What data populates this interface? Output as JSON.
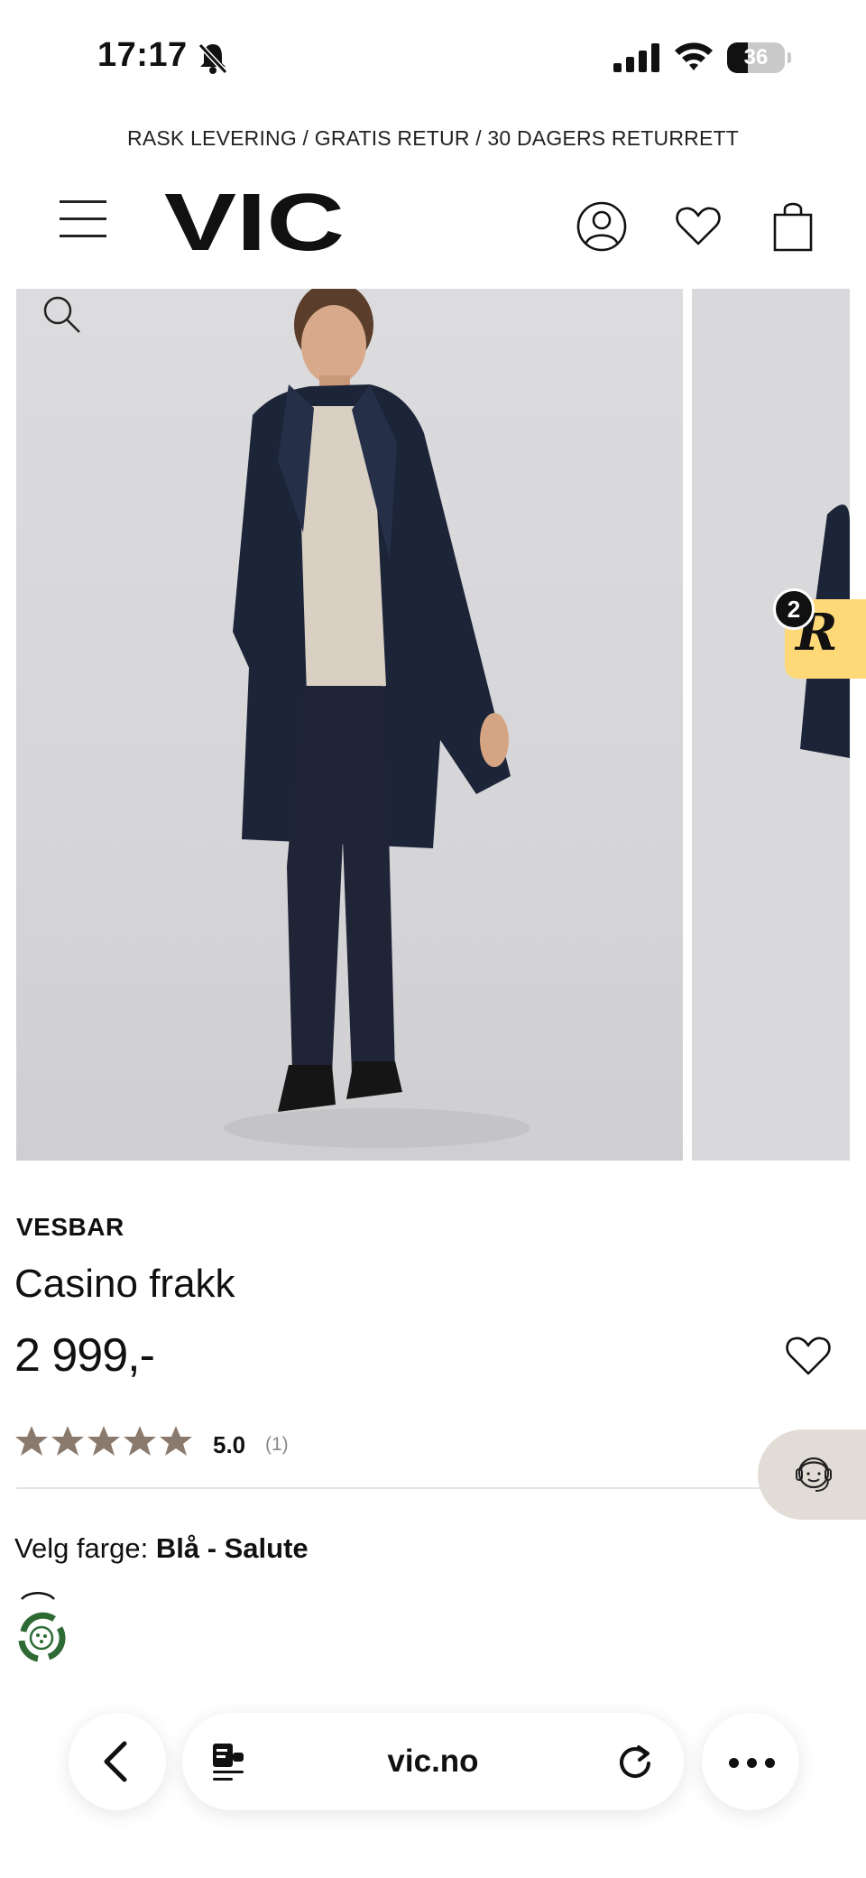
{
  "status_bar": {
    "time": "17:17",
    "battery_level": "36",
    "battery_fraction": 0.36
  },
  "promo": {
    "text": "RASK LEVERING / GRATIS RETUR / 30 DAGERS RETURRETT"
  },
  "header": {
    "logo_text": "VIC",
    "icons": [
      "menu-icon",
      "account-icon",
      "heart-icon",
      "bag-icon"
    ]
  },
  "gallery": {
    "icons": [
      "search-icon"
    ]
  },
  "reviews_widget": {
    "badge_count": "2",
    "letter": "R",
    "color": "#ffd978"
  },
  "product": {
    "brand": "VESBAR",
    "name": "Casino frakk",
    "price": "2 999,-",
    "rating_value": "5.0",
    "rating_count": "(1)",
    "stars": 5,
    "star_color": "#8a7a6e",
    "color_label": "Velg farge:",
    "color_value": "Blå - Salute"
  },
  "support_button": {
    "icon": "support-agent-icon",
    "color": "#e2dcd6"
  },
  "browser": {
    "url": "vic.no",
    "icons": [
      "back-icon",
      "reader-icon",
      "reload-icon",
      "more-icon"
    ]
  }
}
